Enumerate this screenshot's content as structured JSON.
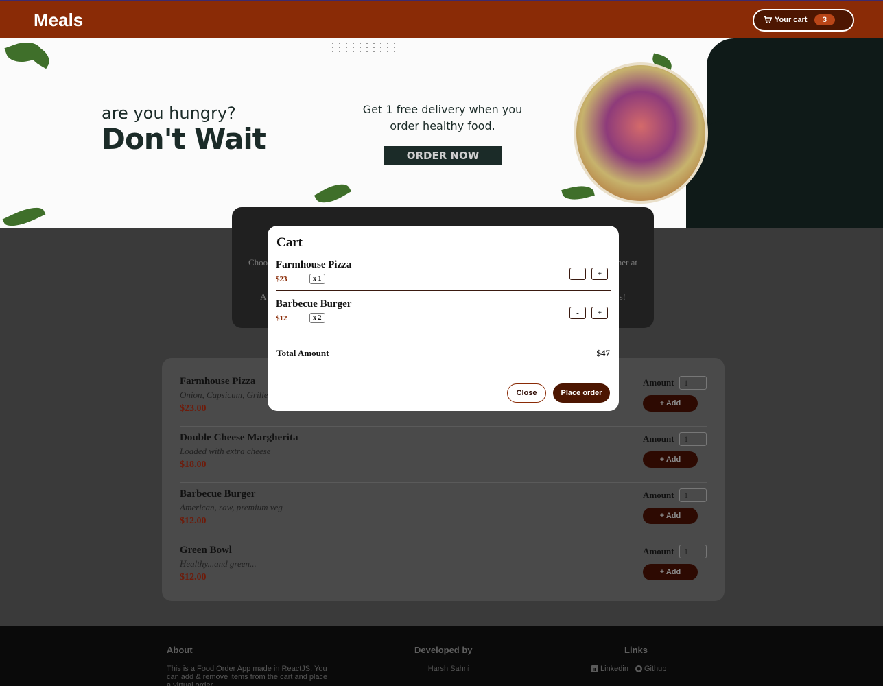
{
  "header": {
    "logo": "Meals",
    "cart_label": "Your cart",
    "cart_count": "3"
  },
  "hero": {
    "tagline": "are you hungry?",
    "headline": "Don't Wait",
    "promo": "Get 1 free delivery when you order healthy food.",
    "cta": "ORDER NOW"
  },
  "summary": {
    "line1_left": "Choo",
    "line1_right": "ner at",
    "line2_left": "A",
    "line2_right": "s!"
  },
  "meals": [
    {
      "name": "Farmhouse Pizza",
      "description": "Onion, Capsicum, Grilled",
      "price": "$23.00",
      "amount_label": "Amount",
      "amount": "1",
      "add_label": "+ Add"
    },
    {
      "name": "Double Cheese Margherita",
      "description": "Loaded with extra cheese",
      "price": "$18.00",
      "amount_label": "Amount",
      "amount": "1",
      "add_label": "+ Add"
    },
    {
      "name": "Barbecue Burger",
      "description": "American, raw, premium veg",
      "price": "$12.00",
      "amount_label": "Amount",
      "amount": "1",
      "add_label": "+ Add"
    },
    {
      "name": "Green Bowl",
      "description": "Healthy...and green...",
      "price": "$12.00",
      "amount_label": "Amount",
      "amount": "1",
      "add_label": "+ Add"
    }
  ],
  "footer": {
    "about_title": "About",
    "about_text": "This is a Food Order App made in ReactJS. You can add & remove items from the cart and place a virtual order.",
    "dev_title": "Developed by",
    "dev_name": "Harsh Sahni",
    "links_title": "Links",
    "link_linkedin": "Linkedin",
    "link_github": "Github"
  },
  "cart_modal": {
    "title": "Cart",
    "items": [
      {
        "name": "Farmhouse Pizza",
        "price": "$23",
        "qty": "x 1",
        "minus": "-",
        "plus": "+"
      },
      {
        "name": "Barbecue Burger",
        "price": "$12",
        "qty": "x 2",
        "minus": "-",
        "plus": "+"
      }
    ],
    "total_label": "Total Amount",
    "total_value": "$47",
    "close_label": "Close",
    "order_label": "Place order"
  },
  "colors": {
    "header": "#8a2b06",
    "primary_dark": "#4d1601",
    "price": "#8a2b06"
  }
}
